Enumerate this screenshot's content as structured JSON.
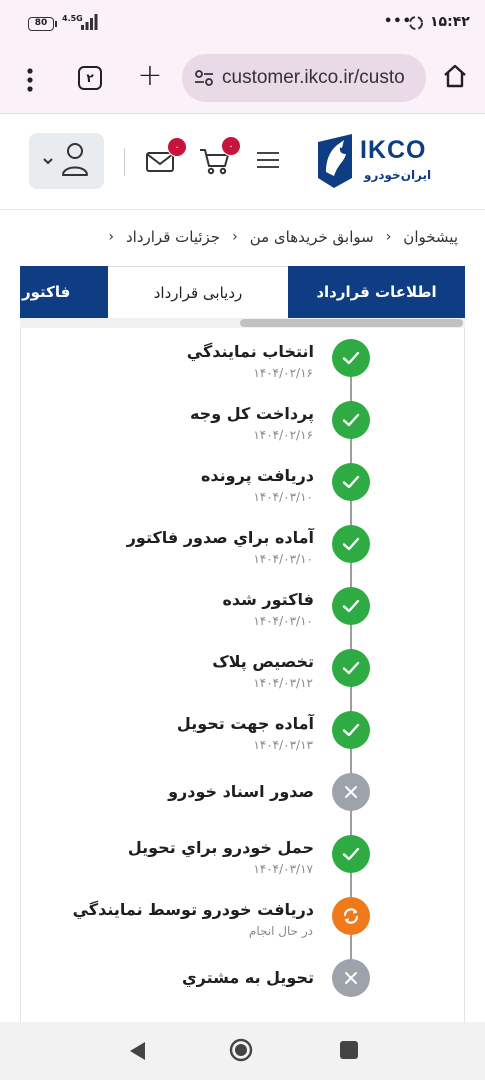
{
  "status_bar": {
    "battery": "80",
    "network": "4.5G",
    "dots": "•••",
    "time": "۱۵:۴۲"
  },
  "browser": {
    "tab_count": "۲",
    "url": "customer.ikco.ir/custo"
  },
  "header": {
    "logo_text": "IKCO",
    "logo_subtext": "ایران‌خودرو",
    "cart_badge": "۰",
    "mail_badge": "۰"
  },
  "breadcrumb": {
    "items": [
      "پیشخوان",
      "سوابق خریدهای من",
      "جزئیات قرارداد"
    ],
    "separator": "‹"
  },
  "tabs": {
    "right": "اطلاعات قرارداد",
    "middle": "ردیابی قرارداد",
    "left": "فاکتور"
  },
  "timeline": [
    {
      "title": "انتخاب نمایندگي",
      "date": "۱۴۰۴/۰۲/۱۶",
      "status": "done"
    },
    {
      "title": "پرداخت کل وجه",
      "date": "۱۴۰۴/۰۲/۱۶",
      "status": "done"
    },
    {
      "title": "دریافت پرونده",
      "date": "۱۴۰۴/۰۳/۱۰",
      "status": "done"
    },
    {
      "title": "آماده براي صدور فاکتور",
      "date": "۱۴۰۴/۰۳/۱۰",
      "status": "done"
    },
    {
      "title": "فاکتور شده",
      "date": "۱۴۰۴/۰۳/۱۰",
      "status": "done"
    },
    {
      "title": "تخصيص پلاک",
      "date": "۱۴۰۴/۰۳/۱۲",
      "status": "done"
    },
    {
      "title": "آماده جهت تحويل",
      "date": "۱۴۰۴/۰۳/۱۳",
      "status": "done"
    },
    {
      "title": "صدور اسناد خودرو",
      "date": "",
      "status": "skipped"
    },
    {
      "title": "حمل خودرو براي تحويل",
      "date": "۱۴۰۴/۰۳/۱۷",
      "status": "done"
    },
    {
      "title": "دریافت خودرو توسط نمایندگي",
      "date": "در حال انجام",
      "status": "in-progress"
    },
    {
      "title": "تحویل به مشتري",
      "date": "",
      "status": "skipped"
    }
  ],
  "colors": {
    "brand_blue": "#0f3d84",
    "done_green": "#2eab43",
    "skipped_gray": "#9ea3ab",
    "progress_orange": "#f07a1a",
    "badge_red": "#c8143c"
  }
}
